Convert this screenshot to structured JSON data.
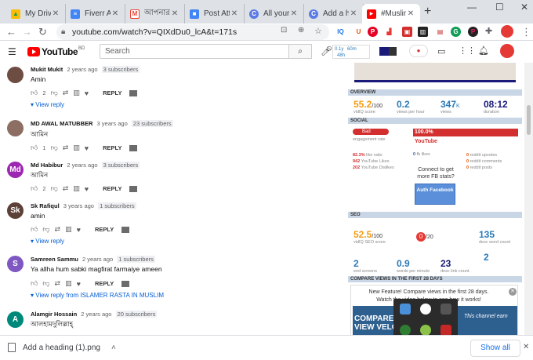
{
  "browser": {
    "tabs": [
      {
        "title": "My Drive",
        "color": "#fbbc04",
        "glyph": "▲"
      },
      {
        "title": "Fiverr Ac",
        "color": "#4285f4",
        "glyph": "≡"
      },
      {
        "title": "আপনার",
        "color": "#ea4335",
        "glyph": "M"
      },
      {
        "title": "Post Atte",
        "color": "#4285f4",
        "glyph": "■"
      },
      {
        "title": "All your c",
        "color": "#5b7be6",
        "glyph": "C"
      },
      {
        "title": "Add a he",
        "color": "#5b7be6",
        "glyph": "C"
      },
      {
        "title": "#Muslim",
        "color": "#ff0000",
        "glyph": "▶"
      }
    ],
    "new_tab": "+",
    "minimize": "—",
    "maximize": "☐",
    "close": "✕",
    "url": "youtube.com/watch?v=QIXdDu0_lcA&t=171s",
    "back": "←",
    "forward": "→",
    "reload": "↻",
    "menu": "⋮"
  },
  "youtube": {
    "logo_text": "YouTube",
    "country_code": "BD",
    "search_placeholder": "Search",
    "search_icon": "search-icon",
    "stats_mini": {
      "views_label": "0.1y",
      "likes": "60m",
      "hours": "48h"
    }
  },
  "comments": [
    {
      "author": "Mukit Mukit",
      "ago": "2 years ago",
      "subs": "3 subscribers",
      "text": "Amin",
      "likes": "2",
      "reply": "REPLY",
      "view_reply": "View reply",
      "avatar_color": "#6d4c41",
      "avatar_letter": ""
    },
    {
      "author": "MD AWAL MATUBBER",
      "ago": "3 years ago",
      "subs": "23 subscribers",
      "text": "আমিন",
      "likes": "1",
      "reply": "REPLY",
      "view_reply": "",
      "avatar_color": "#8d6e63",
      "avatar_letter": ""
    },
    {
      "author": "Md Habibur",
      "ago": "2 years ago",
      "subs": "3 subscribers",
      "text": "আমিন",
      "likes": "2",
      "reply": "REPLY",
      "view_reply": "",
      "avatar_color": "#9c27b0",
      "avatar_letter": "Md"
    },
    {
      "author": "Sk Rafiqul",
      "ago": "3 years ago",
      "subs": "1 subscribers",
      "text": "amin",
      "likes": "",
      "reply": "REPLY",
      "view_reply": "View reply",
      "avatar_color": "#5d4037",
      "avatar_letter": "Sk"
    },
    {
      "author": "Samreen Sammu",
      "ago": "2 years ago",
      "subs": "1 subscribers",
      "text": "Ya allha hum sabki magfirat farmaiye ameen",
      "likes": "",
      "reply": "REPLY",
      "view_reply": "View reply from ISLAMER RASTA IN MUSLIM",
      "avatar_color": "#7e57c2",
      "avatar_letter": "S"
    },
    {
      "author": "Alamgir Hossain",
      "ago": "2 years ago",
      "subs": "20 subscribers",
      "text": "আলহামদুলিল্লাহ্",
      "likes": "",
      "reply": "",
      "view_reply": "",
      "avatar_color": "#00897b",
      "avatar_letter": "A"
    }
  ],
  "panel": {
    "overview": {
      "header": "OVERVIEW",
      "score": "55.2",
      "score_suffix": "/100",
      "score_label": "vidIQ score",
      "views_per_hour": "0.2",
      "views_per_hour_label": "views per hour",
      "views": "347",
      "views_suffix": "K",
      "views_label": "views",
      "duration": "08:12",
      "duration_label": "duration"
    },
    "social": {
      "header": "SOCIAL",
      "engagement_badge": "Bad",
      "engagement_label": "engagement rate",
      "percent": "100.0%",
      "platform": "YouTube",
      "like_ratio": "82.3%",
      "like_ratio_label": "like ratio",
      "likes": "942",
      "likes_label": "YouTube Likes",
      "dislikes": "202",
      "dislikes_label": "YouTube Dislikes",
      "fb_likes": "0",
      "fb_likes_label": "fb likes",
      "reddit": [
        {
          "v": "0",
          "l": "reddit upvotes"
        },
        {
          "v": "0",
          "l": "reddit comments"
        },
        {
          "v": "0",
          "l": "reddit posts"
        }
      ],
      "fb_connect_text": "Connect to get more FB stats?",
      "fb_button": "Auth Facebook"
    },
    "seo": {
      "header": "SEO",
      "score": "52.5",
      "score_suffix": "/100",
      "score_label": "vidIQ SEO score",
      "score2": "0",
      "score2_suffix": "/20",
      "tag_count": "135",
      "tag_count_label": "desc word count",
      "ann": "2",
      "ann_label": "end screens",
      "wpm": "0.9",
      "wpm_label": "words per minute",
      "desc_links": "23",
      "desc_links_label": "desc link count",
      "x2": "2"
    },
    "compare": {
      "header": "COMPARE VIEWS IN THE FIRST 28 DAYS",
      "notice": "New Feature! Compare views in the first 28 days.",
      "notice2": "Watch the video below to see how it works!",
      "video_caption": "COMPARE VIEW",
      "video_caption2": "VIEW VELO",
      "channel_text": "This channel earn"
    }
  },
  "downloads": {
    "file": "Add a heading (1).png",
    "show_all": "Show all",
    "close": "✕"
  },
  "colors": {
    "yt_red": "#ff0000",
    "link_blue": "#065fd4",
    "score_orange": "#f39c12",
    "metric_blue": "#2a7ab8",
    "social_red": "#e53935"
  }
}
